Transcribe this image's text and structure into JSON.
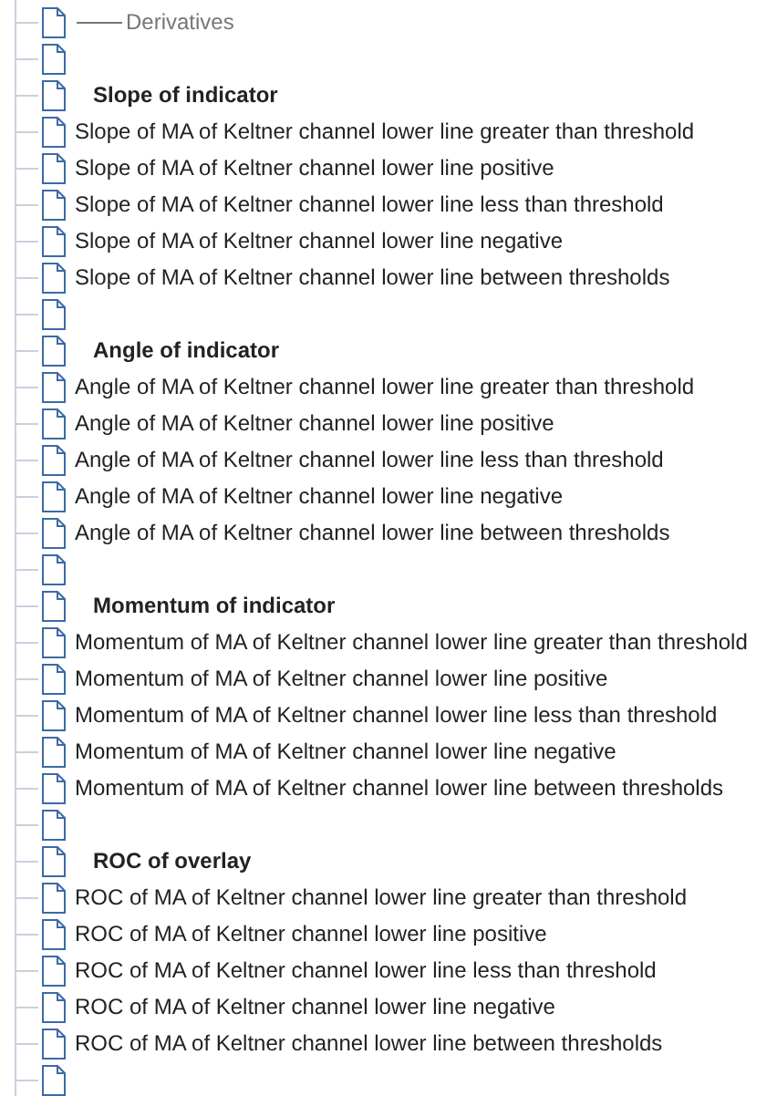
{
  "tree": [
    {
      "kind": "separator",
      "label": "Derivatives"
    },
    {
      "kind": "blank"
    },
    {
      "kind": "header",
      "label": "Slope of indicator"
    },
    {
      "kind": "item",
      "label": "Slope of MA of Keltner channel lower line greater than threshold"
    },
    {
      "kind": "item",
      "label": "Slope of MA of Keltner channel lower line positive"
    },
    {
      "kind": "item",
      "label": "Slope of MA of Keltner channel lower line less than threshold"
    },
    {
      "kind": "item",
      "label": "Slope of MA of Keltner channel lower line negative"
    },
    {
      "kind": "item",
      "label": "Slope of MA of Keltner channel lower line between thresholds"
    },
    {
      "kind": "blank"
    },
    {
      "kind": "header",
      "label": "Angle of indicator"
    },
    {
      "kind": "item",
      "label": "Angle of MA of Keltner channel lower line greater than threshold"
    },
    {
      "kind": "item",
      "label": "Angle of MA of Keltner channel lower line positive"
    },
    {
      "kind": "item",
      "label": "Angle of MA of Keltner channel lower line less than threshold"
    },
    {
      "kind": "item",
      "label": "Angle of MA of Keltner channel lower line negative"
    },
    {
      "kind": "item",
      "label": "Angle of MA of Keltner channel lower line between thresholds"
    },
    {
      "kind": "blank"
    },
    {
      "kind": "header",
      "label": "Momentum of indicator"
    },
    {
      "kind": "item",
      "label": "Momentum of MA of Keltner channel lower line greater than threshold"
    },
    {
      "kind": "item",
      "label": "Momentum of MA of Keltner channel lower line positive"
    },
    {
      "kind": "item",
      "label": "Momentum of MA of Keltner channel lower line less than threshold"
    },
    {
      "kind": "item",
      "label": "Momentum of MA of Keltner channel lower line negative"
    },
    {
      "kind": "item",
      "label": "Momentum of MA of Keltner channel lower line between thresholds"
    },
    {
      "kind": "blank"
    },
    {
      "kind": "header",
      "label": "ROC of overlay"
    },
    {
      "kind": "item",
      "label": "ROC of MA of Keltner channel lower line greater than threshold"
    },
    {
      "kind": "item",
      "label": "ROC of MA of Keltner channel lower line positive"
    },
    {
      "kind": "item",
      "label": "ROC of MA of Keltner channel lower line less than threshold"
    },
    {
      "kind": "item",
      "label": "ROC of MA of Keltner channel lower line negative"
    },
    {
      "kind": "item",
      "label": "ROC of MA of Keltner channel lower line between thresholds"
    },
    {
      "kind": "blank"
    }
  ]
}
